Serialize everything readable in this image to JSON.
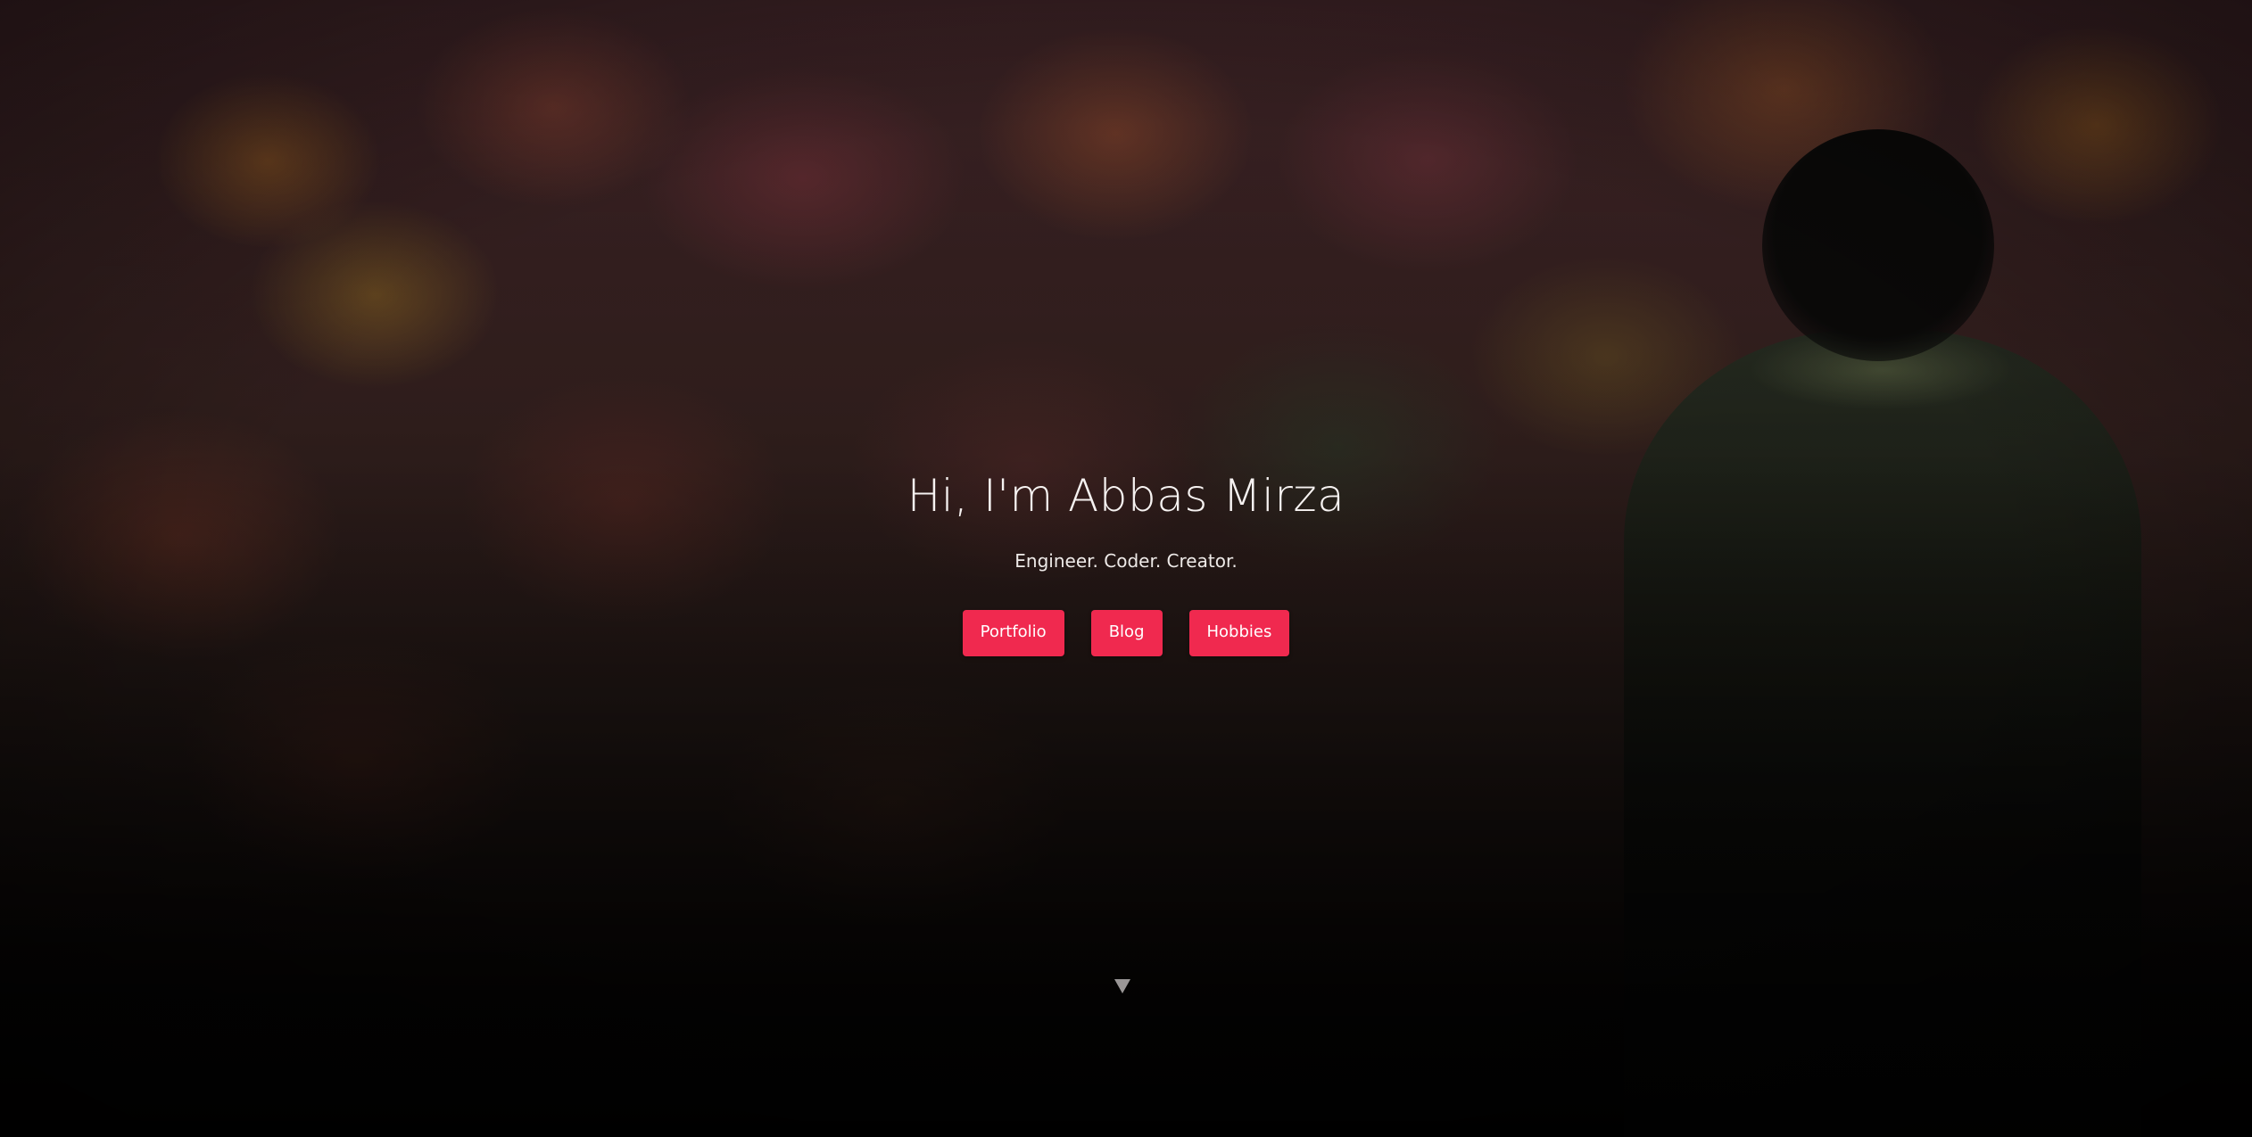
{
  "hero": {
    "title": "Hi, I'm Abbas Mirza",
    "subtitle": "Engineer. Coder. Creator.",
    "buttons": [
      {
        "label": "Portfolio"
      },
      {
        "label": "Blog"
      },
      {
        "label": "Hobbies"
      }
    ],
    "scroll_icon": "triangle-down-icon"
  },
  "colors": {
    "accent": "#f0294f",
    "text": "#f6f2f1"
  }
}
